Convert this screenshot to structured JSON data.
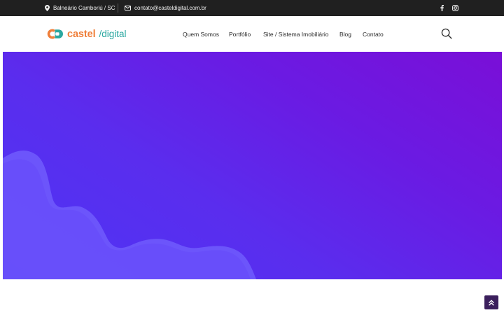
{
  "topbar": {
    "location": "Balneário Camboriú / SC",
    "email": "contato@casteldigital.com.br",
    "social": [
      "facebook-icon",
      "instagram-icon"
    ]
  },
  "header": {
    "logo": {
      "word": "castel",
      "suffix": "/digital"
    },
    "nav": {
      "quem_somos": "Quem Somos",
      "portfolio": "Portfólio",
      "site_sistema": "Site / Sistema Imobiliário",
      "blog": "Blog",
      "contato": "Contato"
    },
    "search_icon": "search-icon"
  },
  "hero": {
    "gradient": [
      "#7a0fd7",
      "#4d35f5"
    ],
    "wave_color": "#6a52fb"
  },
  "colors": {
    "topbar_bg": "#202020",
    "brand_orange": "#ef7f3a",
    "brand_teal": "#2aa7a0",
    "scroll_button": "#3b1f5c"
  },
  "scroll_top_icon": "double-chevron-up-icon"
}
